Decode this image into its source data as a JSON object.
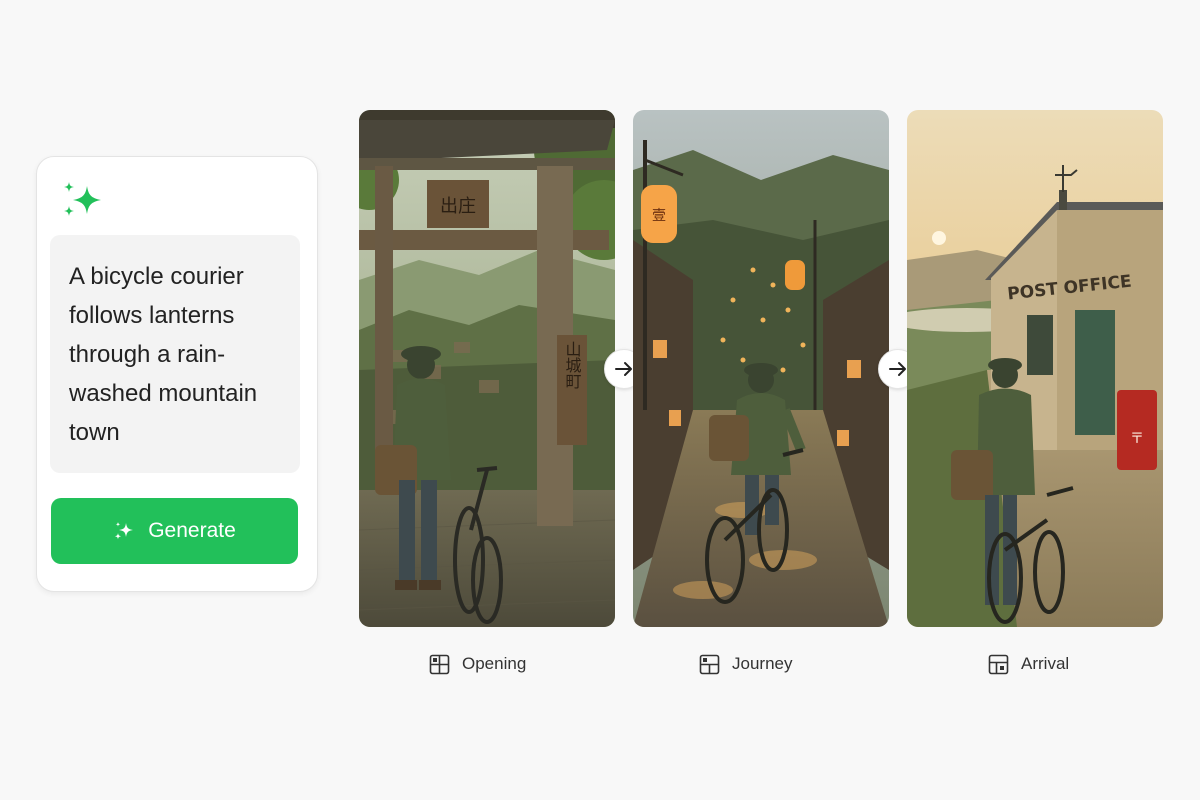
{
  "prompt": {
    "icon": "sparkle-icon",
    "text": "A bicycle courier follows lanterns through a rain-washed mountain town"
  },
  "generate_button": {
    "label": "Generate",
    "icon": "sparkle-icon"
  },
  "colors": {
    "accent": "#22c05a",
    "background": "#f8f8f8"
  },
  "panels": [
    {
      "caption": "Opening",
      "caption_icon": "layout-panel-icon",
      "gate_sign": "山城町",
      "top_sign": "出庄"
    },
    {
      "caption": "Journey",
      "caption_icon": "layout-panel-icon",
      "lantern_sign": "壹"
    },
    {
      "caption": "Arrival",
      "caption_icon": "layout-panel-icon",
      "building_sign": "POST OFFICE",
      "mailbox_mark": "〒"
    }
  ],
  "arrows": [
    {
      "icon": "arrow-right-icon"
    },
    {
      "icon": "arrow-right-icon"
    }
  ]
}
